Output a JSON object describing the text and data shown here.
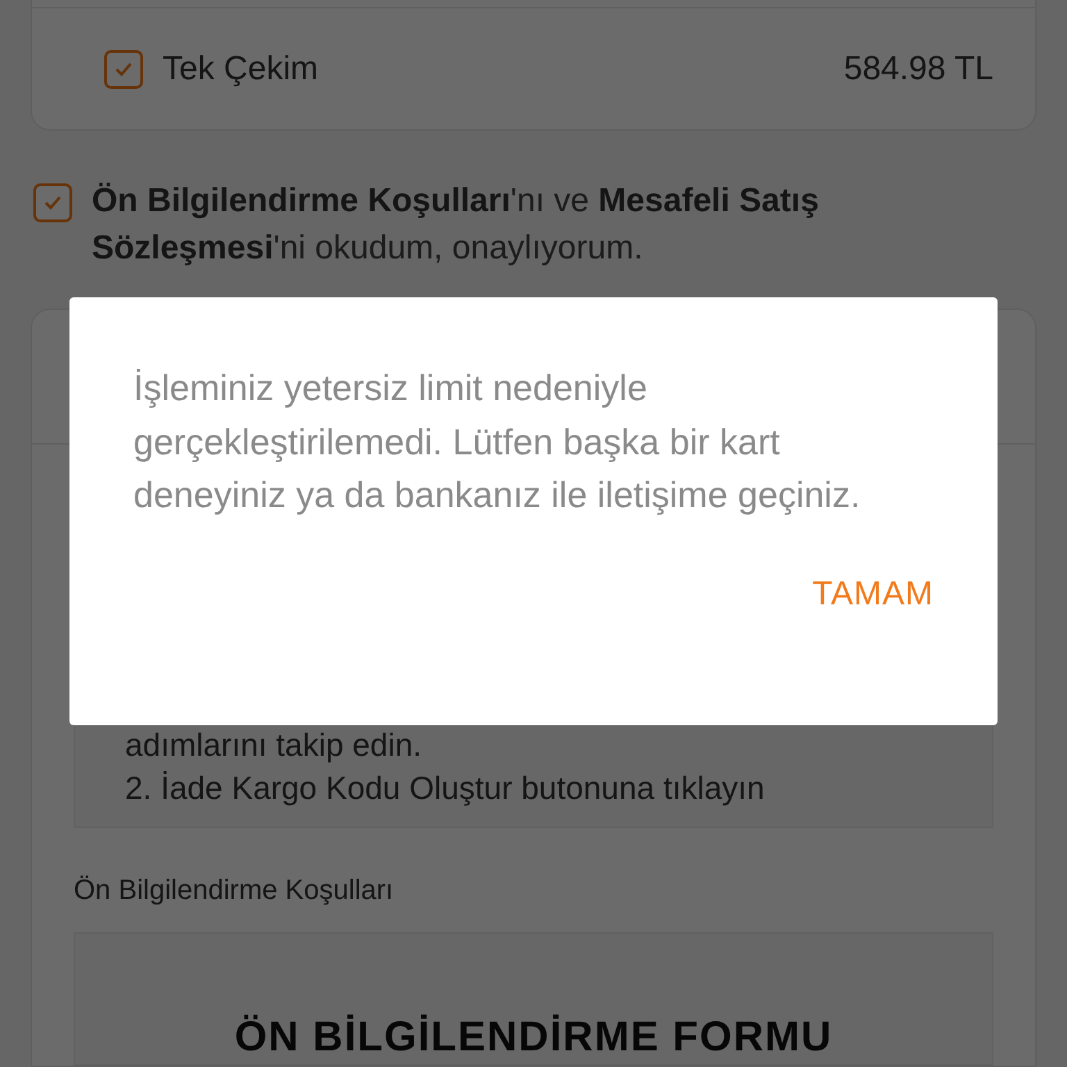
{
  "payment_option": {
    "label": "Tek Çekim",
    "amount": "584.98 TL",
    "checked": true
  },
  "agreement": {
    "text": "**Ön Bilgilendirme Koşulları**'nı ve **Mesafeli Satış Sözleşmesi**'ni okudum, onaylıyorum.",
    "checked": true
  },
  "return_info": {
    "lines": [
      "adımlarını takip edin.",
      "2. İade Kargo Kodu Oluştur butonuna tıklayın"
    ]
  },
  "pre_info": {
    "title": "Ön Bilgilendirme Koşulları",
    "document_heading": "ÖN BİLGİLENDİRME FORMU"
  },
  "dialog": {
    "message": "İşleminiz yetersiz limit nedeniyle gerçekleştirilemedi. Lütfen başka bir kart deneyiniz ya da bankanız ile iletişime geçiniz.",
    "button": "TAMAM"
  }
}
